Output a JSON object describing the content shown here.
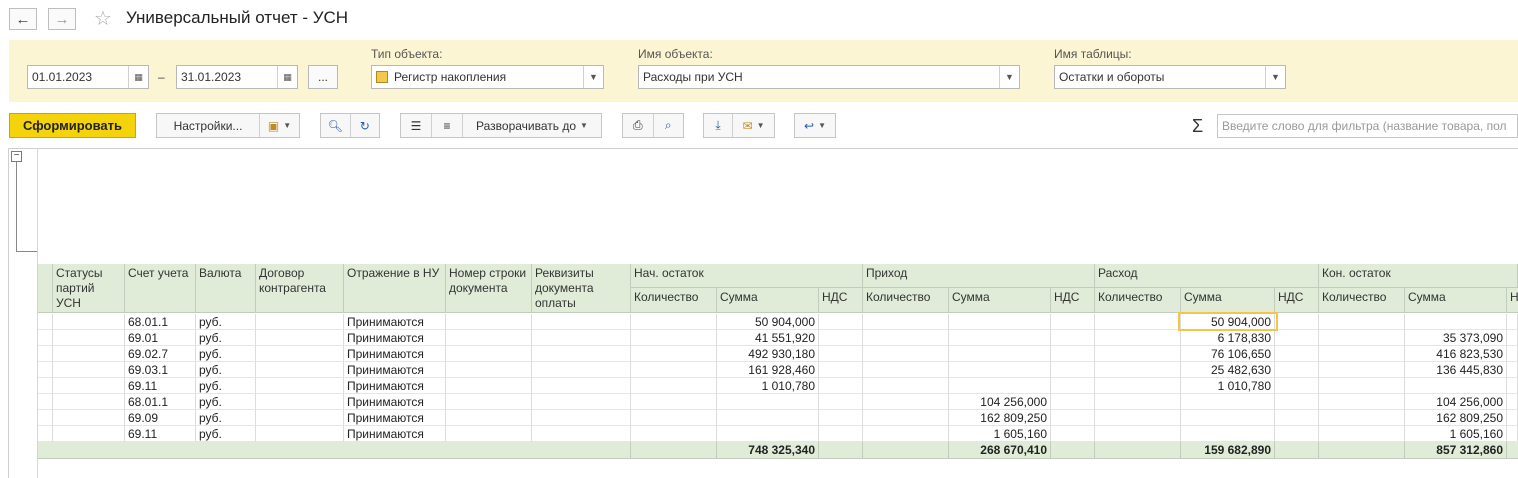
{
  "window": {
    "title": "Универсальный отчет - УСН",
    "back_icon": "arrow-left-icon",
    "forward_icon": "arrow-right-icon",
    "favorite_icon": "star-icon"
  },
  "params": {
    "date_from": "01.01.2023",
    "date_separator": "–",
    "date_to": "31.01.2023",
    "period_button": "...",
    "object_type_label": "Тип объекта:",
    "object_type_value": "Регистр накопления",
    "object_name_label": "Имя объекта:",
    "object_name_value": "Расходы при УСН",
    "table_name_label": "Имя таблицы:",
    "table_name_value": "Остатки и обороты"
  },
  "toolbar": {
    "generate": "Сформировать",
    "settings": "Настройки...",
    "expand_to": "Разворачивать до",
    "search_placeholder": "Введите слово для фильтра (название товара, пол",
    "sigma": "Σ"
  },
  "colors": {
    "param_panel_bg": "#fbf5d3",
    "primary_button": "#f5d30b",
    "header_bg": "#e0ecd8",
    "selection_border": "#f3c64b"
  },
  "table": {
    "headers": {
      "statuses": "Статусы партий УСН",
      "account": "Счет учета",
      "currency": "Валюта",
      "contract": "Договор контрагента",
      "tax": "Отражение в НУ",
      "line_no": "Номер строки документа",
      "payment": "Реквизиты документа оплаты",
      "opening": "Нач. остаток",
      "income": "Приход",
      "expense": "Расход",
      "closing": "Кон. остаток",
      "qty": "Количество",
      "sum": "Сумма",
      "vat": "НДС",
      "vat_partial": "Н"
    },
    "rows": [
      {
        "account": "68.01.1",
        "currency": "руб.",
        "tax": "Принимаются",
        "opening_sum": "50 904,000",
        "income_sum": "",
        "expense_sum": "50 904,000",
        "closing_sum": ""
      },
      {
        "account": "69.01",
        "currency": "руб.",
        "tax": "Принимаются",
        "opening_sum": "41 551,920",
        "income_sum": "",
        "expense_sum": "6 178,830",
        "closing_sum": "35 373,090"
      },
      {
        "account": "69.02.7",
        "currency": "руб.",
        "tax": "Принимаются",
        "opening_sum": "492 930,180",
        "income_sum": "",
        "expense_sum": "76 106,650",
        "closing_sum": "416 823,530"
      },
      {
        "account": "69.03.1",
        "currency": "руб.",
        "tax": "Принимаются",
        "opening_sum": "161 928,460",
        "income_sum": "",
        "expense_sum": "25 482,630",
        "closing_sum": "136 445,830"
      },
      {
        "account": "69.11",
        "currency": "руб.",
        "tax": "Принимаются",
        "opening_sum": "1 010,780",
        "income_sum": "",
        "expense_sum": "1 010,780",
        "closing_sum": ""
      },
      {
        "account": "68.01.1",
        "currency": "руб.",
        "tax": "Принимаются",
        "opening_sum": "",
        "income_sum": "104 256,000",
        "expense_sum": "",
        "closing_sum": "104 256,000"
      },
      {
        "account": "69.09",
        "currency": "руб.",
        "tax": "Принимаются",
        "opening_sum": "",
        "income_sum": "162 809,250",
        "expense_sum": "",
        "closing_sum": "162 809,250"
      },
      {
        "account": "69.11",
        "currency": "руб.",
        "tax": "Принимаются",
        "opening_sum": "",
        "income_sum": "1 605,160",
        "expense_sum": "",
        "closing_sum": "1 605,160"
      }
    ],
    "totals": {
      "opening_sum": "748 325,340",
      "income_sum": "268 670,410",
      "expense_sum": "159 682,890",
      "closing_sum": "857 312,860"
    }
  }
}
